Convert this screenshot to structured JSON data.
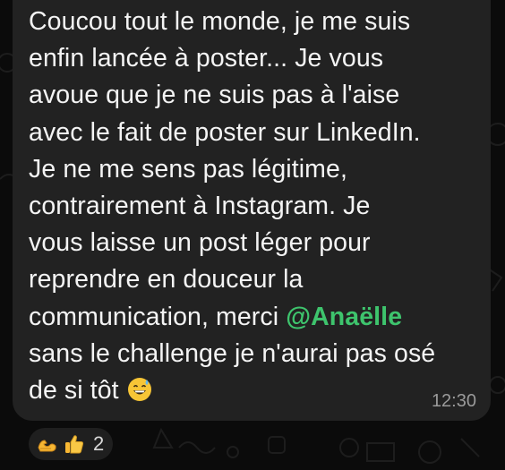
{
  "message": {
    "lines": [
      "Coucou tout le monde, je me suis",
      "enfin lancée à poster... Je vous",
      "avoue que je ne suis pas à l'aise",
      "avec le fait de poster sur LinkedIn.",
      "Je ne me sens pas légitime,",
      "contrairement à Instagram. Je",
      "vous laisse un post léger pour",
      "reprendre en douceur la"
    ],
    "line9_before": "communication, merci ",
    "mention": "@Anaëlle",
    "line10": "sans le challenge je n'aurai pas osé",
    "line11": "de si tôt ",
    "emoji": "grinning-face-with-sweat-icon",
    "time": "12:30"
  },
  "reactions": {
    "emojis": [
      "muscle-arm-icon",
      "thumbs-up-icon"
    ],
    "count": "2"
  },
  "colors": {
    "background": "#0b0b0b",
    "bubble": "#222222",
    "text": "#f4f4f4",
    "mention": "#3ec46d",
    "time": "#9a9a9a"
  }
}
